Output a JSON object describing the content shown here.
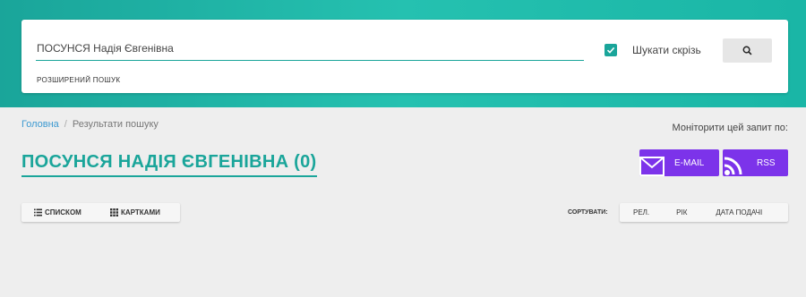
{
  "search": {
    "query": "ПОСУНСЯ Надія Євгенівна",
    "advanced_label": "РОЗШИРЕНИЙ ПОШУК",
    "checkbox_label": "Шукати скрізь",
    "checkbox_checked": true,
    "button_icon": "search-icon"
  },
  "breadcrumb": {
    "home": "Головна",
    "separator": "/",
    "current": "Результати пошуку"
  },
  "monitor": {
    "label": "Моніторити цей запит по:",
    "email_label": "E-MAIL",
    "email_icon": "envelope-icon",
    "rss_label": "RSS",
    "rss_icon": "rss-icon"
  },
  "title": "ПОСУНСЯ НАДІЯ ЄВГЕНІВНА (0)",
  "view": {
    "list_label": "СПИСКОМ",
    "list_icon": "list-icon",
    "cards_label": "КАРТКАМИ",
    "cards_icon": "grid-icon"
  },
  "sort": {
    "label": "СОРТУВАТИ:",
    "options": [
      "РЕЛ.",
      "РІК",
      "ДАТА ПОДАЧІ"
    ]
  },
  "colors": {
    "accent": "#1aa59a",
    "purple": "#7c33ea",
    "link": "#3d9ad1",
    "background": "#eeeeee"
  }
}
